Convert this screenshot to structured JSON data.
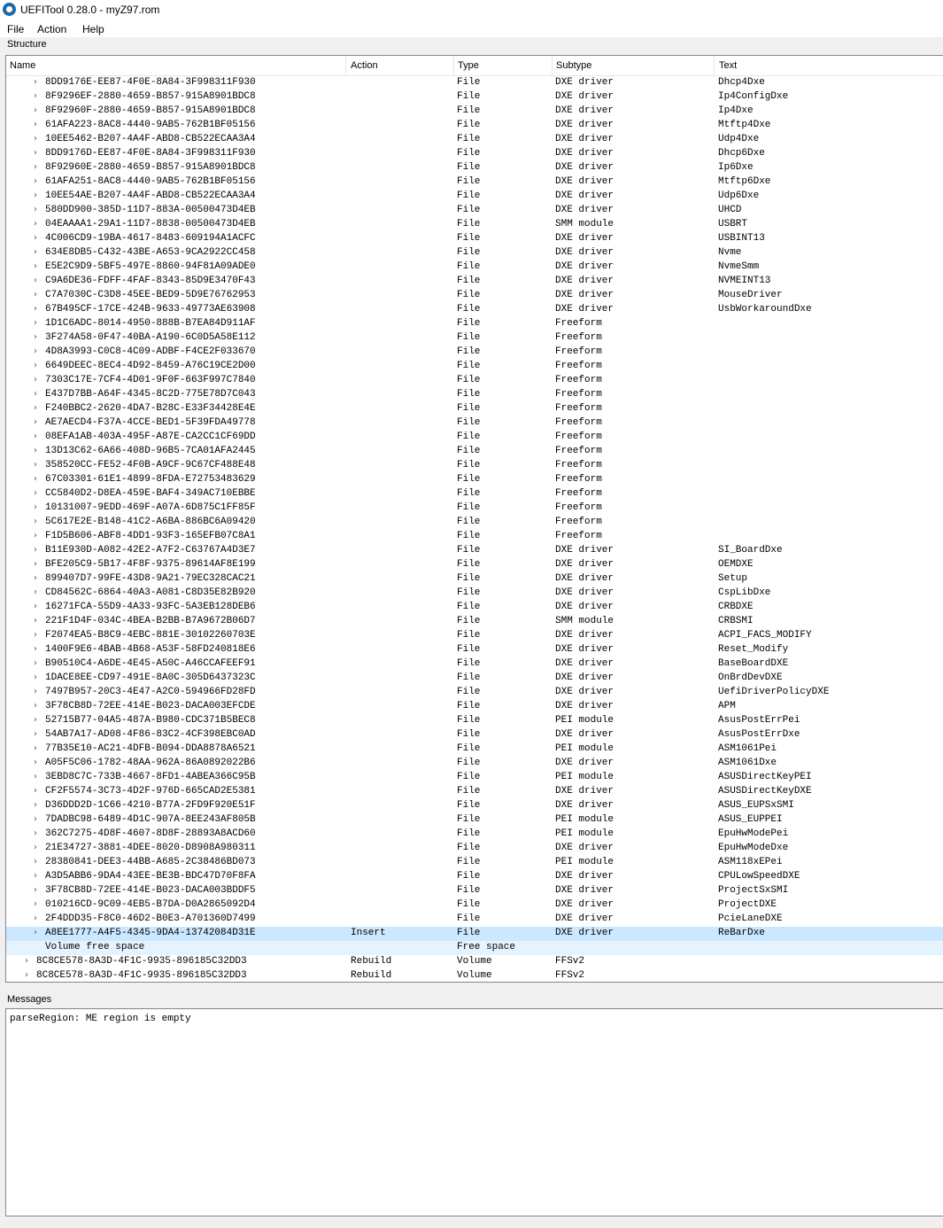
{
  "window": {
    "title": "UEFITool 0.28.0 - myZ97.rom"
  },
  "menu": {
    "file": "File",
    "action": "Action",
    "help": "Help"
  },
  "structure": {
    "label": "Structure",
    "columns": {
      "name": "Name",
      "action": "Action",
      "type": "Type",
      "subtype": "Subtype",
      "text": "Text"
    },
    "rows": [
      {
        "name": "8DD9176E-EE87-4F0E-8A84-3F998311F930",
        "action": "",
        "type": "File",
        "subtype": "DXE driver",
        "text": "Dhcp4Dxe",
        "expander": true,
        "level": 2
      },
      {
        "name": "8F9296EF-2880-4659-B857-915A8901BDC8",
        "action": "",
        "type": "File",
        "subtype": "DXE driver",
        "text": "Ip4ConfigDxe",
        "expander": true,
        "level": 2
      },
      {
        "name": "8F92960F-2880-4659-B857-915A8901BDC8",
        "action": "",
        "type": "File",
        "subtype": "DXE driver",
        "text": "Ip4Dxe",
        "expander": true,
        "level": 2
      },
      {
        "name": "61AFA223-8AC8-4440-9AB5-762B1BF05156",
        "action": "",
        "type": "File",
        "subtype": "DXE driver",
        "text": "Mtftp4Dxe",
        "expander": true,
        "level": 2
      },
      {
        "name": "10EE5462-B207-4A4F-ABD8-CB522ECAA3A4",
        "action": "",
        "type": "File",
        "subtype": "DXE driver",
        "text": "Udp4Dxe",
        "expander": true,
        "level": 2
      },
      {
        "name": "8DD9176D-EE87-4F0E-8A84-3F998311F930",
        "action": "",
        "type": "File",
        "subtype": "DXE driver",
        "text": "Dhcp6Dxe",
        "expander": true,
        "level": 2
      },
      {
        "name": "8F92960E-2880-4659-B857-915A8901BDC8",
        "action": "",
        "type": "File",
        "subtype": "DXE driver",
        "text": "Ip6Dxe",
        "expander": true,
        "level": 2
      },
      {
        "name": "61AFA251-8AC8-4440-9AB5-762B1BF05156",
        "action": "",
        "type": "File",
        "subtype": "DXE driver",
        "text": "Mtftp6Dxe",
        "expander": true,
        "level": 2
      },
      {
        "name": "10EE54AE-B207-4A4F-ABD8-CB522ECAA3A4",
        "action": "",
        "type": "File",
        "subtype": "DXE driver",
        "text": "Udp6Dxe",
        "expander": true,
        "level": 2
      },
      {
        "name": "580DD900-385D-11D7-883A-00500473D4EB",
        "action": "",
        "type": "File",
        "subtype": "DXE driver",
        "text": "UHCD",
        "expander": true,
        "level": 2
      },
      {
        "name": "04EAAAA1-29A1-11D7-8838-00500473D4EB",
        "action": "",
        "type": "File",
        "subtype": "SMM module",
        "text": "USBRT",
        "expander": true,
        "level": 2
      },
      {
        "name": "4C006CD9-19BA-4617-8483-609194A1ACFC",
        "action": "",
        "type": "File",
        "subtype": "DXE driver",
        "text": "USBINT13",
        "expander": true,
        "level": 2
      },
      {
        "name": "634E8DB5-C432-43BE-A653-9CA2922CC458",
        "action": "",
        "type": "File",
        "subtype": "DXE driver",
        "text": "Nvme",
        "expander": true,
        "level": 2
      },
      {
        "name": "E5E2C9D9-5BF5-497E-8860-94F81A09ADE0",
        "action": "",
        "type": "File",
        "subtype": "DXE driver",
        "text": "NvmeSmm",
        "expander": true,
        "level": 2
      },
      {
        "name": "C9A6DE36-FDFF-4FAF-8343-85D9E3470F43",
        "action": "",
        "type": "File",
        "subtype": "DXE driver",
        "text": "NVMEINT13",
        "expander": true,
        "level": 2
      },
      {
        "name": "C7A7030C-C3D8-45EE-BED9-5D9E76762953",
        "action": "",
        "type": "File",
        "subtype": "DXE driver",
        "text": "MouseDriver",
        "expander": true,
        "level": 2
      },
      {
        "name": "67B495CF-17CE-424B-9633-49773AE63908",
        "action": "",
        "type": "File",
        "subtype": "DXE driver",
        "text": "UsbWorkaroundDxe",
        "expander": true,
        "level": 2
      },
      {
        "name": "1D1C6ADC-8014-4950-888B-B7EA84D911AF",
        "action": "",
        "type": "File",
        "subtype": "Freeform",
        "text": "",
        "expander": true,
        "level": 2
      },
      {
        "name": "3F274A58-0F47-40BA-A190-6C0D5A58E112",
        "action": "",
        "type": "File",
        "subtype": "Freeform",
        "text": "",
        "expander": true,
        "level": 2
      },
      {
        "name": "4D8A3993-C0C8-4C09-ADBF-F4CE2F033670",
        "action": "",
        "type": "File",
        "subtype": "Freeform",
        "text": "",
        "expander": true,
        "level": 2
      },
      {
        "name": "6649DEEC-8EC4-4D92-8459-A76C19CE2D00",
        "action": "",
        "type": "File",
        "subtype": "Freeform",
        "text": "",
        "expander": true,
        "level": 2
      },
      {
        "name": "7303C17E-7CF4-4D01-9F0F-663F997C7840",
        "action": "",
        "type": "File",
        "subtype": "Freeform",
        "text": "",
        "expander": true,
        "level": 2
      },
      {
        "name": "E437D7BB-A64F-4345-8C2D-775E78D7C043",
        "action": "",
        "type": "File",
        "subtype": "Freeform",
        "text": "",
        "expander": true,
        "level": 2
      },
      {
        "name": "F240BBC2-2620-4DA7-B28C-E33F34428E4E",
        "action": "",
        "type": "File",
        "subtype": "Freeform",
        "text": "",
        "expander": true,
        "level": 2
      },
      {
        "name": "AE7AECD4-F37A-4CCE-BED1-5F39FDA49778",
        "action": "",
        "type": "File",
        "subtype": "Freeform",
        "text": "",
        "expander": true,
        "level": 2
      },
      {
        "name": "08EFA1AB-403A-495F-A87E-CA2CC1CF69DD",
        "action": "",
        "type": "File",
        "subtype": "Freeform",
        "text": "",
        "expander": true,
        "level": 2
      },
      {
        "name": "13D13C62-6A66-408D-96B5-7CA01AFA2445",
        "action": "",
        "type": "File",
        "subtype": "Freeform",
        "text": "",
        "expander": true,
        "level": 2
      },
      {
        "name": "358520CC-FE52-4F0B-A9CF-9C67CF488E48",
        "action": "",
        "type": "File",
        "subtype": "Freeform",
        "text": "",
        "expander": true,
        "level": 2
      },
      {
        "name": "67C03301-61E1-4899-8FDA-E72753483629",
        "action": "",
        "type": "File",
        "subtype": "Freeform",
        "text": "",
        "expander": true,
        "level": 2
      },
      {
        "name": "CC5840D2-D8EA-459E-BAF4-349AC710EBBE",
        "action": "",
        "type": "File",
        "subtype": "Freeform",
        "text": "",
        "expander": true,
        "level": 2
      },
      {
        "name": "10131007-9EDD-469F-A07A-6D875C1FF85F",
        "action": "",
        "type": "File",
        "subtype": "Freeform",
        "text": "",
        "expander": true,
        "level": 2
      },
      {
        "name": "5C617E2E-B148-41C2-A6BA-886BC6A09420",
        "action": "",
        "type": "File",
        "subtype": "Freeform",
        "text": "",
        "expander": true,
        "level": 2
      },
      {
        "name": "F1D5B606-ABF8-4DD1-93F3-165EFB07C8A1",
        "action": "",
        "type": "File",
        "subtype": "Freeform",
        "text": "",
        "expander": true,
        "level": 2
      },
      {
        "name": "B11E930D-A082-42E2-A7F2-C63767A4D3E7",
        "action": "",
        "type": "File",
        "subtype": "DXE driver",
        "text": "SI_BoardDxe",
        "expander": true,
        "level": 2
      },
      {
        "name": "BFE205C9-5B17-4F8F-9375-89614AF8E199",
        "action": "",
        "type": "File",
        "subtype": "DXE driver",
        "text": "OEMDXE",
        "expander": true,
        "level": 2
      },
      {
        "name": "899407D7-99FE-43D8-9A21-79EC328CAC21",
        "action": "",
        "type": "File",
        "subtype": "DXE driver",
        "text": "Setup",
        "expander": true,
        "level": 2
      },
      {
        "name": "CD84562C-6864-40A3-A081-C8D35E82B920",
        "action": "",
        "type": "File",
        "subtype": "DXE driver",
        "text": "CspLibDxe",
        "expander": true,
        "level": 2
      },
      {
        "name": "16271FCA-55D9-4A33-93FC-5A3EB128DEB6",
        "action": "",
        "type": "File",
        "subtype": "DXE driver",
        "text": "CRBDXE",
        "expander": true,
        "level": 2
      },
      {
        "name": "221F1D4F-034C-4BEA-B2BB-B7A9672B06D7",
        "action": "",
        "type": "File",
        "subtype": "SMM module",
        "text": "CRBSMI",
        "expander": true,
        "level": 2
      },
      {
        "name": "F2074EA5-B8C9-4EBC-881E-30102260703E",
        "action": "",
        "type": "File",
        "subtype": "DXE driver",
        "text": "ACPI_FACS_MODIFY",
        "expander": true,
        "level": 2
      },
      {
        "name": "1400F9E6-4BAB-4B68-A53F-58FD240818E6",
        "action": "",
        "type": "File",
        "subtype": "DXE driver",
        "text": "Reset_Modify",
        "expander": true,
        "level": 2
      },
      {
        "name": "B90510C4-A6DE-4E45-A50C-A46CCAFEEF91",
        "action": "",
        "type": "File",
        "subtype": "DXE driver",
        "text": "BaseBoardDXE",
        "expander": true,
        "level": 2
      },
      {
        "name": "1DACE8EE-CD97-491E-8A0C-305D6437323C",
        "action": "",
        "type": "File",
        "subtype": "DXE driver",
        "text": "OnBrdDevDXE",
        "expander": true,
        "level": 2
      },
      {
        "name": "7497B957-20C3-4E47-A2C0-594966FD28FD",
        "action": "",
        "type": "File",
        "subtype": "DXE driver",
        "text": "UefiDriverPolicyDXE",
        "expander": true,
        "level": 2
      },
      {
        "name": "3F78CB8D-72EE-414E-B023-DACA003EFCDE",
        "action": "",
        "type": "File",
        "subtype": "DXE driver",
        "text": "APM",
        "expander": true,
        "level": 2
      },
      {
        "name": "52715B77-04A5-487A-B980-CDC371B5BEC8",
        "action": "",
        "type": "File",
        "subtype": "PEI module",
        "text": "AsusPostErrPei",
        "expander": true,
        "level": 2
      },
      {
        "name": "54AB7A17-AD08-4F86-83C2-4CF398EBC0AD",
        "action": "",
        "type": "File",
        "subtype": "DXE driver",
        "text": "AsusPostErrDxe",
        "expander": true,
        "level": 2
      },
      {
        "name": "77B35E10-AC21-4DFB-B094-DDA8878A6521",
        "action": "",
        "type": "File",
        "subtype": "PEI module",
        "text": "ASM1061Pei",
        "expander": true,
        "level": 2
      },
      {
        "name": "A05F5C06-1782-48AA-962A-86A0892022B6",
        "action": "",
        "type": "File",
        "subtype": "DXE driver",
        "text": "ASM1061Dxe",
        "expander": true,
        "level": 2
      },
      {
        "name": "3EBD8C7C-733B-4667-8FD1-4ABEA366C95B",
        "action": "",
        "type": "File",
        "subtype": "PEI module",
        "text": "ASUSDirectKeyPEI",
        "expander": true,
        "level": 2
      },
      {
        "name": "CF2F5574-3C73-4D2F-976D-665CAD2E5381",
        "action": "",
        "type": "File",
        "subtype": "DXE driver",
        "text": "ASUSDirectKeyDXE",
        "expander": true,
        "level": 2
      },
      {
        "name": "D36DDD2D-1C66-4210-B77A-2FD9F920E51F",
        "action": "",
        "type": "File",
        "subtype": "DXE driver",
        "text": "ASUS_EUPSxSMI",
        "expander": true,
        "level": 2
      },
      {
        "name": "7DADBC98-6489-4D1C-907A-8EE243AF805B",
        "action": "",
        "type": "File",
        "subtype": "PEI module",
        "text": "ASUS_EUPPEI",
        "expander": true,
        "level": 2
      },
      {
        "name": "362C7275-4D8F-4607-8D8F-28893A8ACD60",
        "action": "",
        "type": "File",
        "subtype": "PEI module",
        "text": "EpuHwModePei",
        "expander": true,
        "level": 2
      },
      {
        "name": "21E34727-3881-4DEE-8020-D8908A980311",
        "action": "",
        "type": "File",
        "subtype": "DXE driver",
        "text": "EpuHwModeDxe",
        "expander": true,
        "level": 2
      },
      {
        "name": "28380841-DEE3-44BB-A685-2C38486BD073",
        "action": "",
        "type": "File",
        "subtype": "PEI module",
        "text": "ASM118xEPei",
        "expander": true,
        "level": 2
      },
      {
        "name": "A3D5ABB6-9DA4-43EE-BE3B-BDC47D70F8FA",
        "action": "",
        "type": "File",
        "subtype": "DXE driver",
        "text": "CPULowSpeedDXE",
        "expander": true,
        "level": 2
      },
      {
        "name": "3F78CB8D-72EE-414E-B023-DACA003BDDF5",
        "action": "",
        "type": "File",
        "subtype": "DXE driver",
        "text": "ProjectSxSMI",
        "expander": true,
        "level": 2
      },
      {
        "name": "010216CD-9C09-4EB5-B7DA-D0A2865092D4",
        "action": "",
        "type": "File",
        "subtype": "DXE driver",
        "text": "ProjectDXE",
        "expander": true,
        "level": 2
      },
      {
        "name": "2F4DDD35-F8C0-46D2-B0E3-A701360D7499",
        "action": "",
        "type": "File",
        "subtype": "DXE driver",
        "text": "PcieLaneDXE",
        "expander": true,
        "level": 2
      },
      {
        "name": "A8EE1777-A4F5-4345-9DA4-13742084D31E",
        "action": "Insert",
        "type": "File",
        "subtype": "DXE driver",
        "text": "ReBarDxe",
        "expander": true,
        "level": 2,
        "selected": true
      },
      {
        "name": "Volume free space",
        "action": "",
        "type": "Free space",
        "subtype": "",
        "text": "",
        "expander": false,
        "level": 2,
        "highlight": true
      },
      {
        "name": "8C8CE578-8A3D-4F1C-9935-896185C32DD3",
        "action": "Rebuild",
        "type": "Volume",
        "subtype": "FFSv2",
        "text": "",
        "expander": true,
        "level": 1
      },
      {
        "name": "8C8CE578-8A3D-4F1C-9935-896185C32DD3",
        "action": "Rebuild",
        "type": "Volume",
        "subtype": "FFSv2",
        "text": "",
        "expander": true,
        "level": 1
      }
    ]
  },
  "messages": {
    "label": "Messages",
    "items": [
      "parseRegion: ME region is empty"
    ]
  },
  "colors": {
    "selected_row": "#cce8ff",
    "highlight_row": "#e5f3ff",
    "app_icon": "#1c6aa8"
  }
}
